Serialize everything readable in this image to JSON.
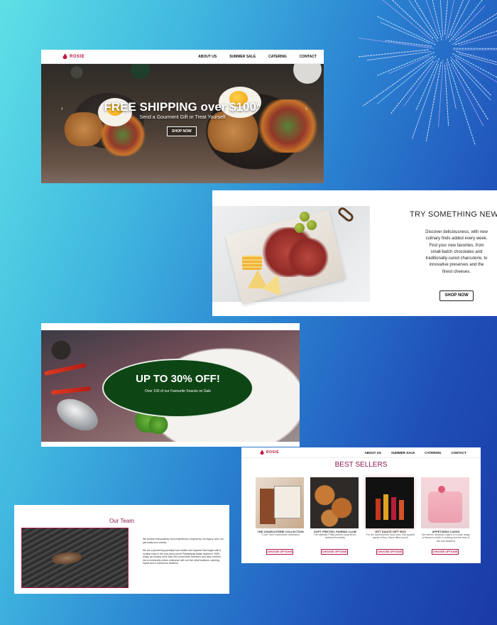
{
  "brand": {
    "name": "ROSIE",
    "accent": "#b0173e",
    "heading_color": "#8a1a4d"
  },
  "nav": {
    "items": [
      "ABOUT US",
      "SUMMER SALE",
      "CATERING",
      "CONTACT"
    ]
  },
  "hero": {
    "title": "FREE SHIPPING over $100*",
    "subtitle": "Send a Gourment Gift or Treat Yourself",
    "button": "SHOP NOW",
    "prev_icon": "chevron-left-icon",
    "next_icon": "chevron-right-icon"
  },
  "try_new": {
    "title": "TRY SOMETHING NEW",
    "body": "Discover deliciousness, with new culinary finds added every week. Find your new favorites, from small-batch chocolates and traditionally-cured charcuterie, to innovative preserves and the finest cheeses.",
    "button": "SHOP NOW"
  },
  "sale": {
    "title": "UP TO 30% OFF!",
    "subtitle": "Over 100 of our Favourite Snacks on Sale",
    "oval_color": "#0e4515"
  },
  "best_sellers": {
    "title": "BEST SELLERS",
    "products": [
      {
        "name": "THE CHARCUTERIE COLLECTION",
        "desc": "\"Cure\" their charcuterie obsession",
        "button": "CHOOSE OPTIONS"
      },
      {
        "name": "SOFT PRETZEL PAIRING CLUB",
        "desc": "The ultimate Philly pretzel experience, delivered monthly",
        "button": "CHOOSE OPTIONS"
      },
      {
        "name": "HOT SAUCE GIFT BOX",
        "desc": "For the adventurous heat lover, this quartet packs a fiery, flavor-filled punch",
        "button": "CHOOSE OPTIONS"
      },
      {
        "name": "APPETIZING CAKES",
        "desc": "We deliver delicious cakes of a wide range of flavours which is nothing but the best of the rest desserts",
        "button": "CHOOSE OPTIONS"
      }
    ]
  },
  "team": {
    "title": "Our Team",
    "para1": "We provide extraordinary food experiences, inspired by our legacy. Also, we just really love cheese.",
    "para2": "We are a pioneering specialty food retailer and importer that began with a modest shop in the now-iconic North Philadelphia Italian Market in 1959; today, we employ more than 250 proud team members and have evolved into a community-driven enterprise with our five retail locations, catering, import and e-commerce divisions."
  }
}
